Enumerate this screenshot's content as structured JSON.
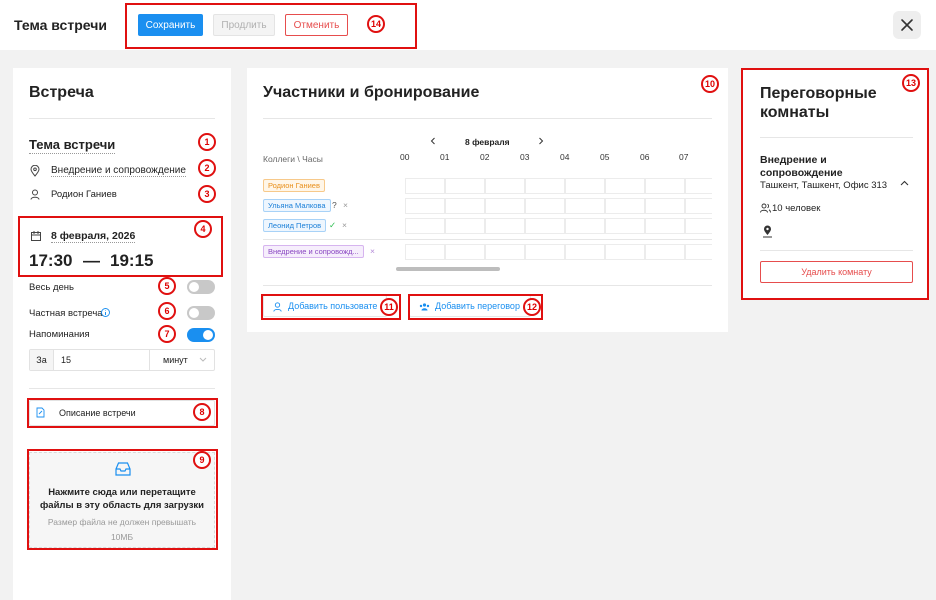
{
  "header": {
    "title": "Тема встречи",
    "save_label": "Сохранить",
    "extend_label": "Продлить",
    "cancel_label": "Отменить"
  },
  "markers": [
    "1",
    "2",
    "3",
    "4",
    "5",
    "6",
    "7",
    "8",
    "9",
    "10",
    "11",
    "12",
    "13",
    "14"
  ],
  "left": {
    "heading": "Встреча",
    "topic": "Тема встречи",
    "location": "Внедрение и сопровождение",
    "organizer": "Родион Ганиев",
    "date": "8 февраля, 2026",
    "time_start": "17:30",
    "time_dash": "—",
    "time_end": "19:15",
    "all_day_label": "Весь день",
    "private_label": "Частная встреча",
    "reminders_label": "Напоминания",
    "reminder_prefix": "За",
    "reminder_value": "15",
    "reminder_unit": "минут",
    "description_label": "Описание встречи",
    "upload_title": "Нажмите сюда или перетащите файлы в эту область для загрузки",
    "upload_hint": "Размер файла не должен превышать 10МБ",
    "all_day_on": false,
    "private_on": false,
    "reminders_on": true
  },
  "middle": {
    "heading": "Участники и бронирование",
    "date_label": "8 февраля",
    "axis_label": "Коллеги \\ Часы",
    "hours": [
      "00",
      "01",
      "02",
      "03",
      "04",
      "05",
      "06",
      "07"
    ],
    "participants": [
      {
        "name": "Родион Ганиев",
        "status": ""
      },
      {
        "name": "Ульяна Малкова",
        "status": "?"
      },
      {
        "name": "Леонид Петров",
        "status": "✓"
      }
    ],
    "room": "Внедрение и сопровожд...",
    "add_user_label": "Добавить пользовате",
    "add_room_label": "Добавить переговор"
  },
  "right": {
    "heading": "Переговорные комнаты",
    "room_name": "Внедрение и сопровождение",
    "room_address": "Ташкент, Ташкент, Офис 313",
    "room_capacity": "10 человек",
    "delete_label": "Удалить комнату"
  },
  "colors": {
    "primary": "#1a8ff0",
    "danger": "#e64d4d",
    "annotation": "#e01010",
    "organizer_chip": "#f5a030",
    "participant_chip": "#1a8ff0",
    "room_chip": "#9b59d0"
  }
}
